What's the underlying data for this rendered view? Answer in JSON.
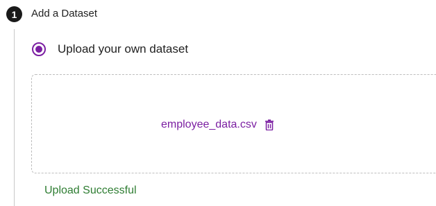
{
  "step": {
    "number": "1",
    "title": "Add a Dataset"
  },
  "upload_option": {
    "label": "Upload your own dataset",
    "selected": true,
    "accent_color": "#7b1fa2"
  },
  "dropzone": {
    "file_name": "employee_data.csv",
    "delete_icon": "trash-icon"
  },
  "status": {
    "text": "Upload Successful",
    "color": "#2e7d32"
  }
}
